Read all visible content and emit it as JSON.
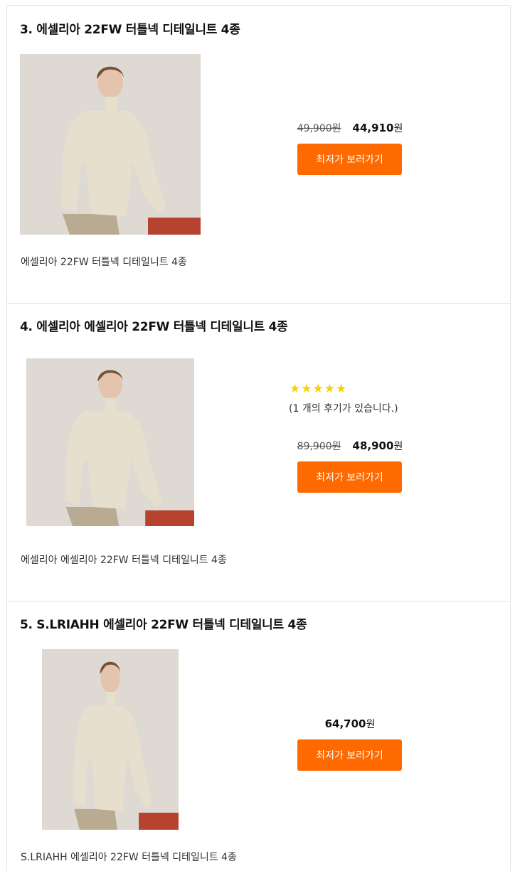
{
  "products": [
    {
      "title": "3. 에셀리아 22FW 터틀넥 디테일니트 4종",
      "stars": "",
      "review_text": "",
      "old_price": "49,900원",
      "new_price_num": "44,910",
      "new_price_unit": "원",
      "button_label": "최저가 보러가기",
      "description": "에셀리아 22FW 터틀넥 디테일니트 4종"
    },
    {
      "title": "4. 에셀리아 에셀리아 22FW 터틀넥 디테일니트 4종",
      "stars": "★★★★★",
      "review_text": "(1 개의 후기가 있습니다.)",
      "old_price": "89,900원",
      "new_price_num": "48,900",
      "new_price_unit": "원",
      "button_label": "최저가 보러가기",
      "description": "에셀리아 에셀리아 22FW 터틀넥 디테일니트 4종"
    },
    {
      "title": "5. S.LRIAHH 에셀리아 22FW 터틀넥 디테일니트 4종",
      "stars": "",
      "review_text": "",
      "old_price": "",
      "new_price_num": "64,700",
      "new_price_unit": "원",
      "button_label": "최저가 보러가기",
      "description": "S.LRIAHH 에셀리아 22FW 터틀넥 디테일니트 4종"
    }
  ],
  "colors": {
    "button": "#ff6a00",
    "stars": "#f5d300",
    "border": "#e4e4e4"
  },
  "icons": {
    "rating": "star-icon",
    "product_image": "sweater-photo"
  }
}
